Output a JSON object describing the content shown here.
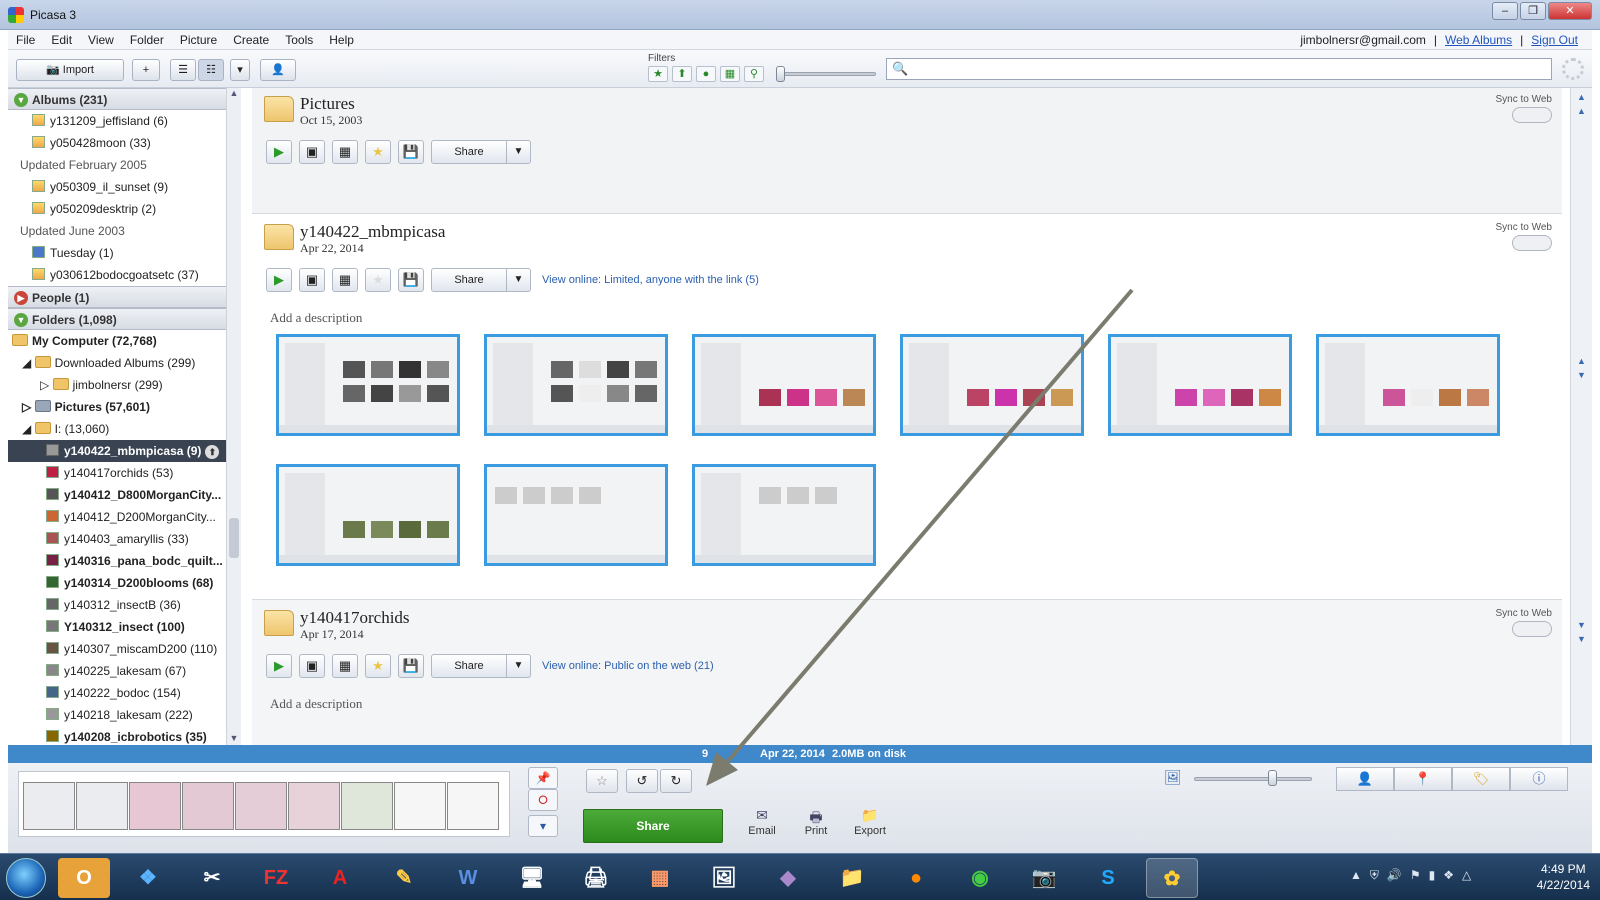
{
  "window": {
    "title": "Picasa 3",
    "min": "–",
    "max": "❐",
    "close": "✕"
  },
  "menu": {
    "items": [
      "File",
      "Edit",
      "View",
      "Folder",
      "Picture",
      "Create",
      "Tools",
      "Help"
    ],
    "account": "jimbolnersr@gmail.com",
    "sep": "|",
    "web_albums": "Web Albums",
    "sign_out": "Sign Out"
  },
  "toolbar": {
    "import_label": "Import",
    "filters_label": "Filters",
    "search_placeholder": ""
  },
  "sidebar": {
    "albums_header": "Albums (231)",
    "album_items": [
      {
        "label": "y131209_jeffisland (6)"
      },
      {
        "label": "y050428moon (33)"
      }
    ],
    "group_feb2005": "Updated February 2005",
    "feb_items": [
      {
        "label": "y050309_il_sunset (9)"
      },
      {
        "label": "y050209desktrip (2)"
      }
    ],
    "group_jun2003": "Updated June 2003",
    "jun_items": [
      {
        "label": "Tuesday (1)"
      },
      {
        "label": "y030612bodocgoatsetc (37)"
      }
    ],
    "people_header": "People (1)",
    "folders_header": "Folders (1,098)",
    "my_computer": "My Computer (72,768)",
    "downloaded_albums": "Downloaded Albums (299)",
    "jimbolnersr": "jimbolnersr (299)",
    "pictures": "Pictures (57,601)",
    "drive_i": "I: (13,060)",
    "folder_items": [
      {
        "label": "y140422_mbmpicasa (9)",
        "selected": true
      },
      {
        "label": "y140417orchids (53)"
      },
      {
        "label": "y140412_D800MorganCity...",
        "bold": true
      },
      {
        "label": "y140412_D200MorganCity..."
      },
      {
        "label": "y140403_amaryllis (33)"
      },
      {
        "label": "y140316_pana_bodc_quilt...",
        "bold": true
      },
      {
        "label": "y140314_D200blooms (68)",
        "bold": true
      },
      {
        "label": "y140312_insectB (36)"
      },
      {
        "label": "Y140312_insect (100)",
        "bold": true
      },
      {
        "label": "y140307_miscamD200 (110)"
      },
      {
        "label": "y140225_lakesam (67)"
      },
      {
        "label": "y140222_bodoc (154)"
      },
      {
        "label": "y140218_lakesam (222)"
      },
      {
        "label": "y140208_icbrobotics (35)",
        "bold": true
      }
    ]
  },
  "sections": [
    {
      "title": "Pictures",
      "date": "Oct 15, 2003",
      "sync": "Sync to Web",
      "share": "Share",
      "view_online": ""
    },
    {
      "title": "y140422_mbmpicasa",
      "date": "Apr 22, 2014",
      "sync": "Sync to Web",
      "share": "Share",
      "view_online": "View online: Limited, anyone with the link (5)",
      "add_description": "Add a description"
    },
    {
      "title": "y140417orchids",
      "date": "Apr 17, 2014",
      "sync": "Sync to Web",
      "share": "Share",
      "view_online": "View online: Public on the web (21)",
      "add_description": "Add a description"
    }
  ],
  "status": {
    "count": "9",
    "date": "Apr 22, 2014",
    "size": "2.0MB on disk"
  },
  "bottom": {
    "share": "Share",
    "email": "Email",
    "print": "Print",
    "export": "Export"
  },
  "clock": {
    "time": "4:49 PM",
    "date": "4/22/2014"
  },
  "colors": {
    "status_bar": "#3f88c9",
    "share_green": "#3d9e2c",
    "selection_dark": "#3a4352",
    "thumb_border": "#3b9be0"
  }
}
